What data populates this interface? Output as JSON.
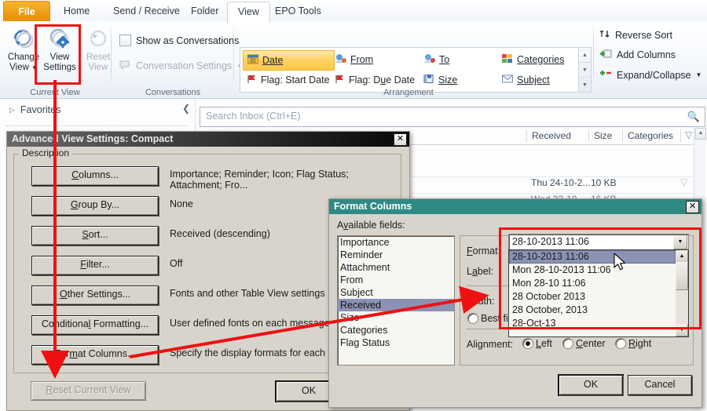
{
  "app": {
    "ribbon_tabs": [
      {
        "label": "File",
        "state": "file"
      },
      {
        "label": "Home",
        "state": "normal"
      },
      {
        "label": "Send / Receive",
        "state": "normal"
      },
      {
        "label": "Folder",
        "state": "normal"
      },
      {
        "label": "View",
        "state": "active"
      },
      {
        "label": "EPO Tools",
        "state": "normal"
      }
    ],
    "groups": [
      {
        "name": "Current View"
      },
      {
        "name": "Conversations"
      },
      {
        "name": "Arrangement"
      }
    ],
    "current_view": {
      "change_view_line1": "Change",
      "change_view_line2": "View",
      "view_settings_line1": "View",
      "view_settings_line2": "Settings",
      "reset_view_line1": "Reset",
      "reset_view_line2": "View"
    },
    "conversations": {
      "show_as_conversations": "Show as Conversations",
      "conversation_settings": "Conversation Settings"
    },
    "arrangement": {
      "gallery": [
        {
          "label": "Date",
          "icon": "date-icon",
          "selected": true
        },
        {
          "label": "From",
          "icon": "from-icon",
          "selected": false
        },
        {
          "label": "To",
          "icon": "to-icon",
          "selected": false
        },
        {
          "label": "Categories",
          "icon": "categories-icon",
          "selected": false
        },
        {
          "label": "Flag: Start Date",
          "icon": "flag-icon",
          "selected": false
        },
        {
          "label": "Flag: Due Date",
          "icon": "flag-icon",
          "selected": false
        },
        {
          "label": "Size",
          "icon": "size-icon",
          "selected": false
        },
        {
          "label": "Subject",
          "icon": "subject-icon",
          "selected": false
        }
      ],
      "reverse_sort": "Reverse Sort",
      "add_columns": "Add Columns",
      "expand_collapse": "Expand/Collapse"
    },
    "navigation": {
      "favorites": "Favorites"
    },
    "search": {
      "placeholder": "Search Inbox (Ctrl+E)"
    },
    "message_list": {
      "columns": [
        "Received",
        "Size",
        "Categories"
      ],
      "rows": [
        {
          "received": "Thu 24-10-2...",
          "size": "10 KB"
        },
        {
          "received": "Wed 23-10-...",
          "size": "16 KB"
        }
      ]
    }
  },
  "advanced_view_settings": {
    "title": "Advanced View Settings: Compact",
    "close_label": "✕",
    "description_legend": "Description",
    "rows": [
      {
        "button": "Columns...",
        "accesskey": "C",
        "value": "Importance; Reminder; Icon; Flag Status; Attachment; Fro..."
      },
      {
        "button": "Group By...",
        "accesskey": "G",
        "value": "None"
      },
      {
        "button": "Sort...",
        "accesskey": "S",
        "value": "Received (descending)"
      },
      {
        "button": "Filter...",
        "accesskey": "F",
        "value": "Off"
      },
      {
        "button": "Other Settings...",
        "accesskey": "O",
        "value": "Fonts and other Table View settings"
      },
      {
        "button": "Conditional Formatting...",
        "accesskey": "l",
        "value": "User defined fonts on each message"
      },
      {
        "button": "Format Columns...",
        "accesskey": "m",
        "value": "Specify the display formats for each field"
      }
    ],
    "reset_button": "Reset Current View",
    "ok_button": "OK"
  },
  "format_columns": {
    "title": "Format Columns",
    "close_label": "✕",
    "available_fields_label": "Available fields:",
    "available_fields": [
      "Importance",
      "Reminder",
      "Attachment",
      "From",
      "Subject",
      "Received",
      "Size",
      "Categories",
      "Flag Status"
    ],
    "selected_field": "Received",
    "format_label": "Format:",
    "label_label": "Label:",
    "width_label": "Width:",
    "best_fit_label": "Best fit",
    "format_value": "28-10-2013 11:06",
    "format_options": [
      "28-10-2013 11:06",
      "Mon 28-10-2013 11:06",
      "Mon 28-10 11:06",
      "28 October 2013",
      "28 October, 2013",
      "28-Oct-13"
    ],
    "format_selected_index": 0,
    "alignment_label": "Alignment:",
    "alignment_options": [
      "Left",
      "Center",
      "Right"
    ],
    "alignment_selected": "Left",
    "ok_button": "OK",
    "cancel_button": "Cancel"
  },
  "annotations": {
    "highlight_color": "#ee1111",
    "boxes": [
      "view-settings-button",
      "format-dropdown"
    ],
    "arrows": [
      "view-settings-to-format-columns",
      "format-columns-to-received-field"
    ]
  }
}
